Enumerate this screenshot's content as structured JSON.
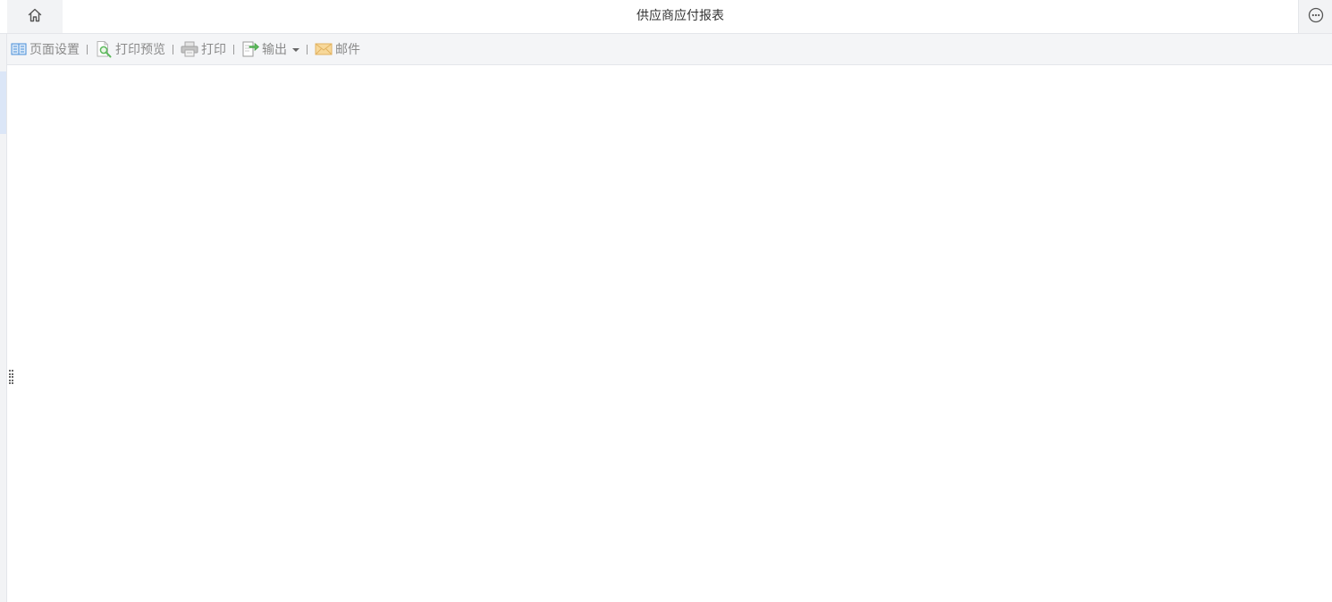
{
  "header": {
    "title": "供应商应付报表",
    "home_icon": "home-icon",
    "more_icon": "more-horizontal-circle-icon"
  },
  "toolbar": {
    "items": [
      {
        "id": "page-setup",
        "label": "页面设置",
        "icon": "page-setup-icon"
      },
      {
        "id": "print-preview",
        "label": "打印预览",
        "icon": "print-preview-icon"
      },
      {
        "id": "print",
        "label": "打印",
        "icon": "printer-icon"
      },
      {
        "id": "export",
        "label": "输出",
        "icon": "export-icon",
        "has_dropdown": true
      },
      {
        "id": "email",
        "label": "邮件",
        "icon": "mail-icon"
      }
    ]
  },
  "colors": {
    "toolbar_bg": "#f4f5f7",
    "header_side_bg": "#f2f3f5",
    "text_muted": "#8a8a8a",
    "accent_blue": "#4a90d9",
    "accent_green": "#5cb85c",
    "mail_orange": "#f0c070"
  }
}
